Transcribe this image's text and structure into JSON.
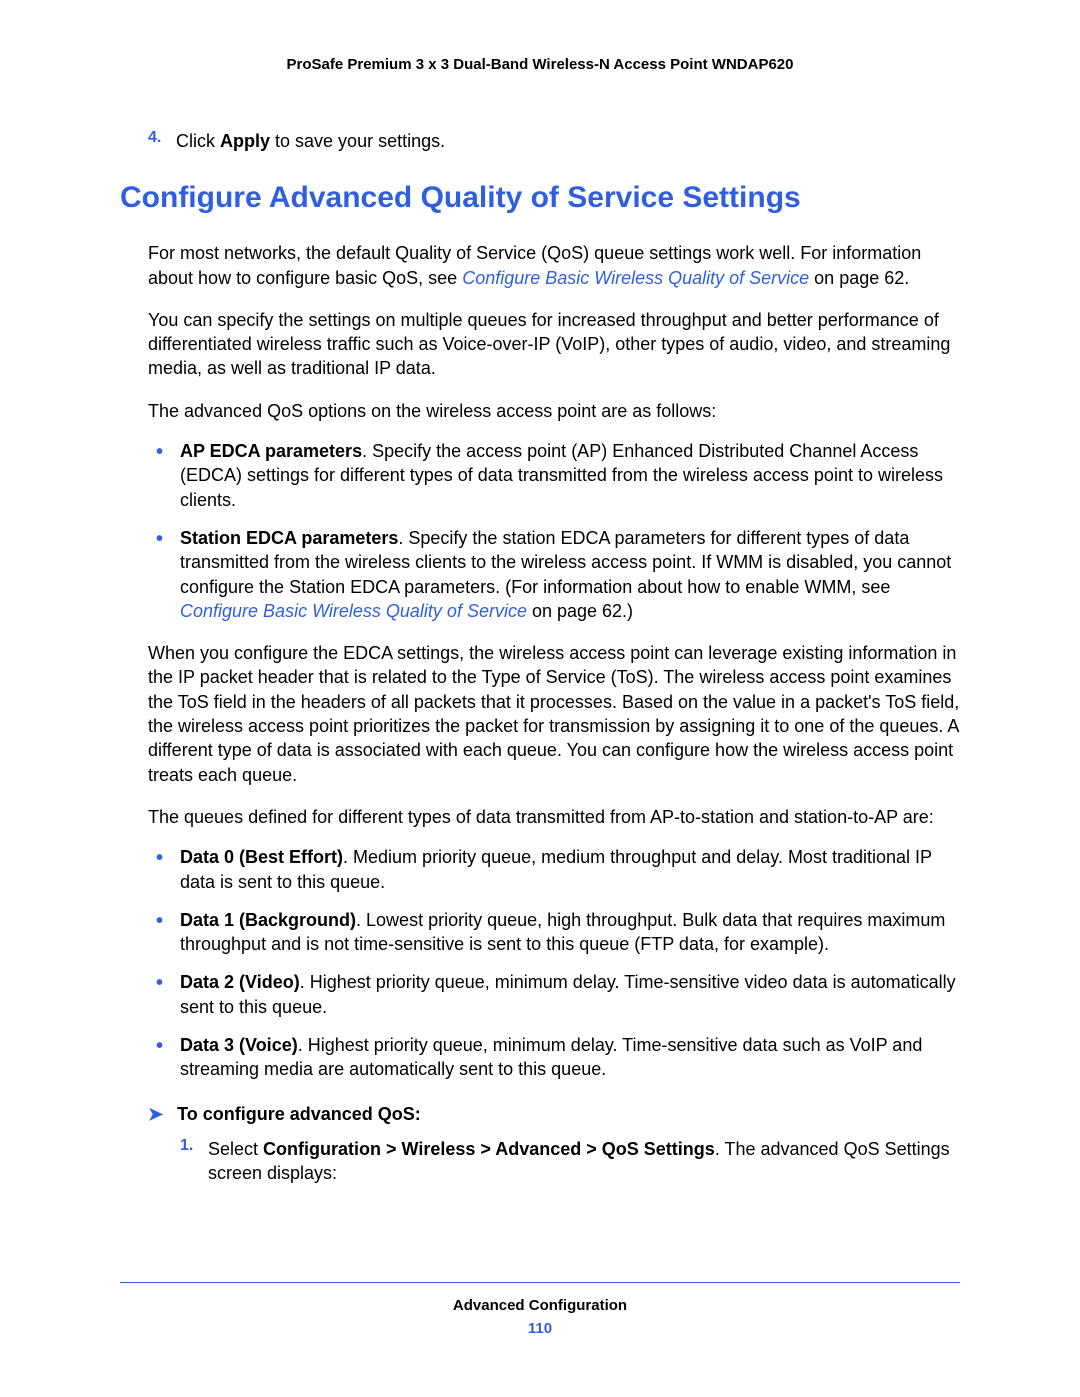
{
  "header": {
    "running_title": "ProSafe Premium 3 x 3 Dual-Band Wireless-N Access Point WNDAP620"
  },
  "step4": {
    "num": "4.",
    "pre": "Click ",
    "bold": "Apply",
    "post": " to save your settings."
  },
  "section_title": "Configure Advanced Quality of Service Settings",
  "para1_a": "For most networks, the default Quality of Service (QoS) queue settings work well. For information about how to configure basic QoS, see ",
  "para1_link": "Configure Basic Wireless Quality of Service",
  "para1_b": " on page 62.",
  "para2": "You can specify the settings on multiple queues for increased throughput and better performance of differentiated wireless traffic such as Voice-over-IP (VoIP), other types of audio, video, and streaming media, as well as traditional IP data.",
  "para3": "The advanced QoS options on the wireless access point are as follows:",
  "options": [
    {
      "bold": "AP EDCA parameters",
      "rest_a": ". Specify the access point (AP) Enhanced Distributed Channel Access (EDCA) settings for different types of data transmitted from the wireless access point to wireless clients.",
      "link": "",
      "rest_b": ""
    },
    {
      "bold": "Station EDCA parameters",
      "rest_a": ". Specify the station EDCA parameters for different types of data transmitted from the wireless clients to the wireless access point. If WMM is disabled, you cannot configure the Station EDCA parameters. (For information about how to enable WMM, see ",
      "link": "Configure Basic Wireless Quality of Service",
      "rest_b": " on page 62.)"
    }
  ],
  "para4": "When you configure the EDCA settings, the wireless access point can leverage existing information in the IP packet header that is related to the Type of Service (ToS). The wireless access point examines the ToS field in the headers of all packets that it processes. Based on the value in a packet's ToS field, the wireless access point prioritizes the packet for transmission by assigning it to one of the queues. A different type of data is associated with each queue. You can configure how the wireless access point treats each queue.",
  "para5": "The queues defined for different types of data transmitted from AP-to-station and station-to-AP are:",
  "queues": [
    {
      "bold": "Data 0 (Best Effort)",
      "rest": ". Medium priority queue, medium throughput and delay. Most traditional IP data is sent to this queue."
    },
    {
      "bold": "Data 1 (Background)",
      "rest": ". Lowest priority queue, high throughput. Bulk data that requires maximum throughput and is not time-sensitive is sent to this queue (FTP data, for example)."
    },
    {
      "bold": "Data 2 (Video)",
      "rest": ". Highest priority queue, minimum delay. Time-sensitive video data is automatically sent to this queue."
    },
    {
      "bold": "Data 3 (Voice)",
      "rest": ". Highest priority queue, minimum delay. Time-sensitive data such as VoIP and streaming media are automatically sent to this queue."
    }
  ],
  "procedure_title": "To configure advanced QoS:",
  "proc_step1": {
    "num": "1.",
    "pre": "Select ",
    "bold": "Configuration > Wireless > Advanced > QoS Settings",
    "post": ". The advanced QoS Settings screen displays:"
  },
  "footer": {
    "section": "Advanced Configuration",
    "page": "110"
  }
}
